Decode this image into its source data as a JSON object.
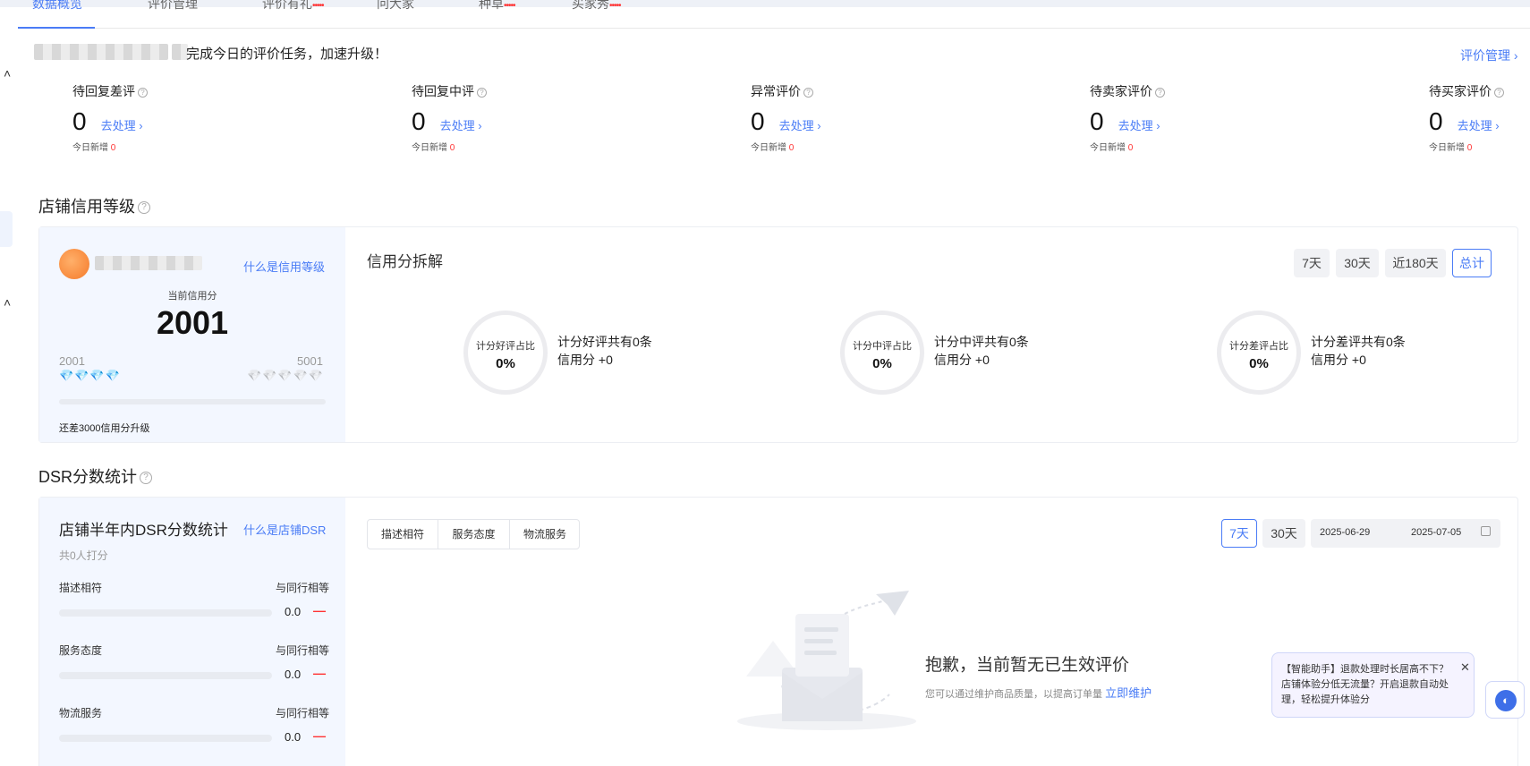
{
  "tabs": [
    {
      "label": "数据概览",
      "badge": ""
    },
    {
      "label": "评价管理",
      "badge": ""
    },
    {
      "label": "评价有礼",
      "badge": "•••••"
    },
    {
      "label": "问大家",
      "badge": ""
    },
    {
      "label": "种草",
      "badge": "•••••"
    },
    {
      "label": "买家秀",
      "badge": "•••••"
    }
  ],
  "banner": {
    "text": "完成今日的评价任务，加速升级！",
    "manage_link": "评价管理 ›"
  },
  "stats": [
    {
      "title": "待回复差评",
      "value": "0",
      "link": "去处理 ›",
      "sub_label": "今日新增",
      "sub_value": "0"
    },
    {
      "title": "待回复中评",
      "value": "0",
      "link": "去处理 ›",
      "sub_label": "今日新增",
      "sub_value": "0"
    },
    {
      "title": "异常评价",
      "value": "0",
      "link": "去处理 ›",
      "sub_label": "今日新增",
      "sub_value": "0"
    },
    {
      "title": "待卖家评价",
      "value": "0",
      "link": "去处理 ›",
      "sub_label": "今日新增",
      "sub_value": "0"
    },
    {
      "title": "待买家评价",
      "value": "0",
      "link": "去处理 ›",
      "sub_label": "今日新增",
      "sub_value": "0"
    }
  ],
  "credit": {
    "section_title": "店铺信用等级",
    "what_link": "什么是信用等级",
    "current_label": "当前信用分",
    "current_value": "2001",
    "min": "2001",
    "max": "5001",
    "progress": 0,
    "upgrade_text": "还差3000信用分升级",
    "breakdown_title": "信用分拆解",
    "periods": [
      "7天",
      "30天",
      "近180天",
      "总计"
    ],
    "selected_period": "总计",
    "rings": [
      {
        "label": "计分好评占比",
        "value": "0%",
        "line1": "计分好评共有0条",
        "line2": "信用分 +0"
      },
      {
        "label": "计分中评占比",
        "value": "0%",
        "line1": "计分中评共有0条",
        "line2": "信用分 +0"
      },
      {
        "label": "计分差评占比",
        "value": "0%",
        "line1": "计分差评共有0条",
        "line2": "信用分 +0"
      }
    ]
  },
  "dsr": {
    "section_title": "DSR分数统计",
    "card_title": "店铺半年内DSR分数统计",
    "what_link": "什么是店铺DSR",
    "raters": "共0人打分",
    "rows": [
      {
        "label": "描述相符",
        "compare": "与同行相等",
        "value": "0.0",
        "trend": "—"
      },
      {
        "label": "服务态度",
        "compare": "与同行相等",
        "value": "0.0",
        "trend": "—"
      },
      {
        "label": "物流服务",
        "compare": "与同行相等",
        "value": "0.0",
        "trend": "—"
      }
    ],
    "segments": [
      "描述相符",
      "服务态度",
      "物流服务"
    ],
    "selected_segment": "描述相符",
    "periods": [
      "7天",
      "30天"
    ],
    "selected_period": "7天",
    "date_start": "2025-06-29",
    "date_end": "2025-07-05",
    "empty_title": "抱歉，当前暂无已生效评价",
    "empty_desc": "您可以通过维护商品质量，以提高订单量",
    "empty_link": "立即维护"
  },
  "assistant": {
    "text": "【智能助手】退款处理时长居高不下？店铺体验分低无流量？开启退款自动处理，轻松提升体验分"
  },
  "colors": {
    "accent": "#4a7cf6",
    "red": "#ff3333",
    "panel": "#f3f7ff"
  }
}
